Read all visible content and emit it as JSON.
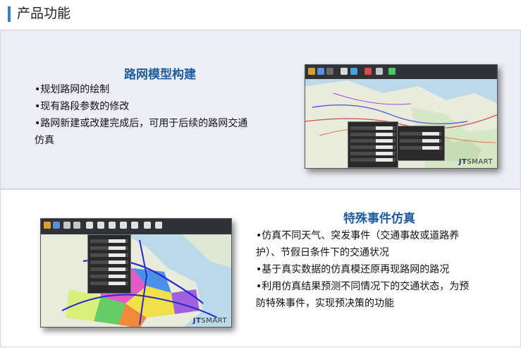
{
  "header": {
    "title": "产品功能"
  },
  "section1": {
    "title": "路网模型构建",
    "bullets": [
      "•规划路网的绘制",
      "•现有路段参数的修改",
      "•路网新建或改建完成后，可用于后续的路网交通",
      "仿真"
    ]
  },
  "section2": {
    "title": "特殊事件仿真",
    "bullets": [
      "•仿真不同天气、突发事件（交通事故或道路养",
      "护）、节假日条件下的交通状况",
      "•基于真实数据的仿真模还原再现路网的路况",
      "•利用仿真结果预测不同情况下的交通状态，为预",
      "防特殊事件，实现预决策的功能"
    ]
  },
  "branding": {
    "jt": "JT",
    "smart": "SMART"
  },
  "colors": {
    "accent_bar": "#3d7fc7",
    "section_title": "#1f5c9c",
    "panel_bg": "#ededf5"
  },
  "icons": [
    "map-screenshot-icon",
    "toolbar-icon"
  ]
}
